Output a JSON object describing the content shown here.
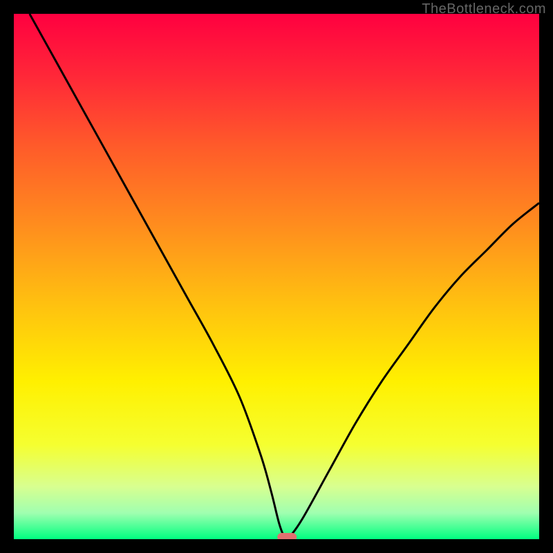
{
  "attribution": "TheBottleneck.com",
  "chart_data": {
    "type": "line",
    "title": "",
    "xlabel": "",
    "ylabel": "",
    "xlim": [
      0,
      100
    ],
    "ylim": [
      0,
      100
    ],
    "background_gradient": {
      "type": "vertical",
      "stops": [
        {
          "pos": 0.0,
          "color": "#ff0040"
        },
        {
          "pos": 0.12,
          "color": "#ff2838"
        },
        {
          "pos": 0.25,
          "color": "#ff5a2a"
        },
        {
          "pos": 0.4,
          "color": "#ff8c1e"
        },
        {
          "pos": 0.55,
          "color": "#ffc010"
        },
        {
          "pos": 0.7,
          "color": "#fff000"
        },
        {
          "pos": 0.82,
          "color": "#f5ff30"
        },
        {
          "pos": 0.9,
          "color": "#d8ff90"
        },
        {
          "pos": 0.95,
          "color": "#a0ffb0"
        },
        {
          "pos": 1.0,
          "color": "#00ff80"
        }
      ]
    },
    "series": [
      {
        "name": "bottleneck-curve",
        "color": "#000000",
        "x": [
          3,
          8,
          13,
          18,
          23,
          28,
          33,
          38,
          43,
          47,
          49,
          50.5,
          51.5,
          52.5,
          55,
          60,
          65,
          70,
          75,
          80,
          85,
          90,
          95,
          100
        ],
        "y": [
          100,
          91,
          82,
          73,
          64,
          55,
          46,
          37,
          27,
          16,
          9,
          3,
          0.5,
          0.5,
          4,
          13,
          22,
          30,
          37,
          44,
          50,
          55,
          60,
          64
        ]
      }
    ],
    "marker": {
      "name": "optimal-point",
      "x": 52,
      "y": 0,
      "color": "#e07070",
      "shape": "pill"
    }
  }
}
